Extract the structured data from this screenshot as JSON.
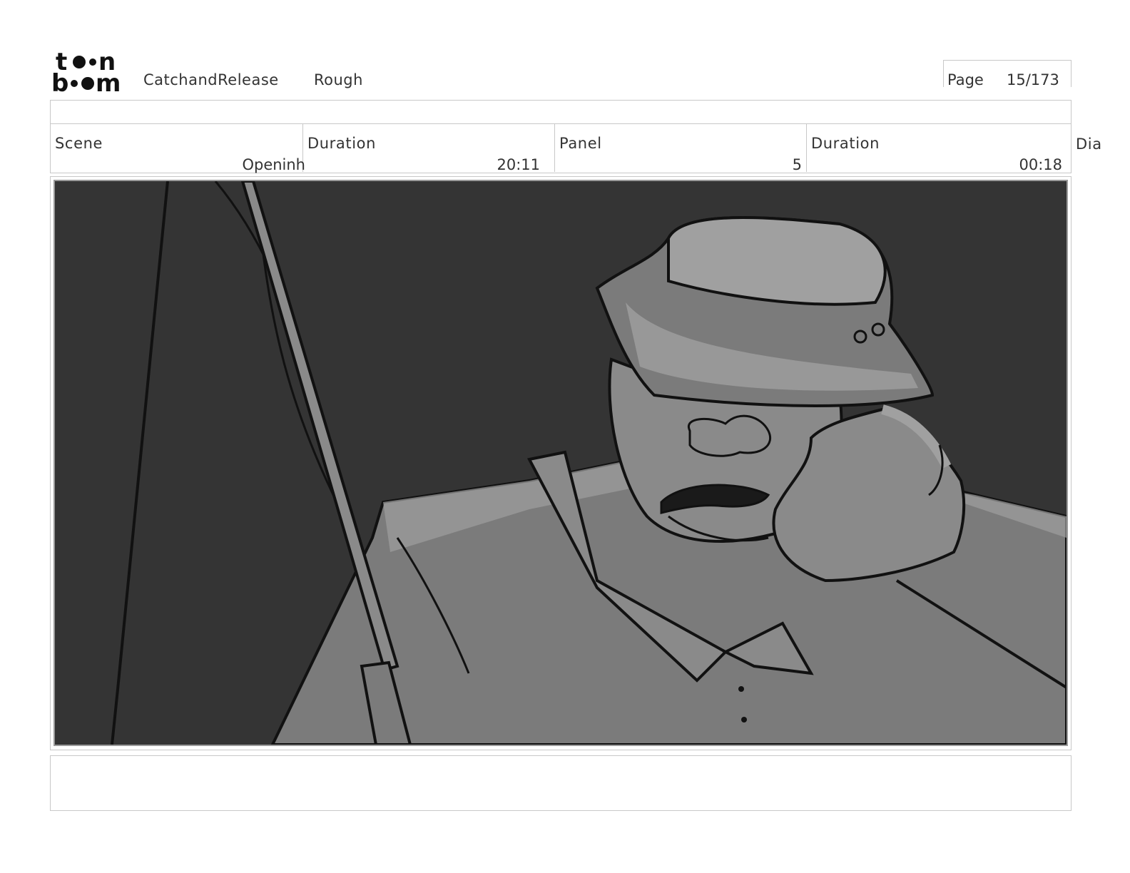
{
  "header": {
    "logo": {
      "text_top": "toon",
      "text_bottom": "boom",
      "icon": "toonboom-logo"
    },
    "project": "CatchandRelease",
    "stage": "Rough",
    "page_label": "Page",
    "page_value": "15/173"
  },
  "info": {
    "scene_label": "Scene",
    "scene_value": "Openinh",
    "scene_duration_label": "Duration",
    "scene_duration_value": "20:11",
    "panel_label": "Panel",
    "panel_value": "5",
    "panel_duration_label": "Duration",
    "panel_duration_value": "00:18",
    "dialogue_label": "Dia"
  },
  "panel": {
    "image": "storyboard-panel-fisherman-in-bucket-hat",
    "colors": {
      "background": "#343434",
      "shirt": "#7b7b7b",
      "highlight": "#a0a0a0",
      "line": "#111111"
    }
  },
  "notes": {
    "text": ""
  }
}
